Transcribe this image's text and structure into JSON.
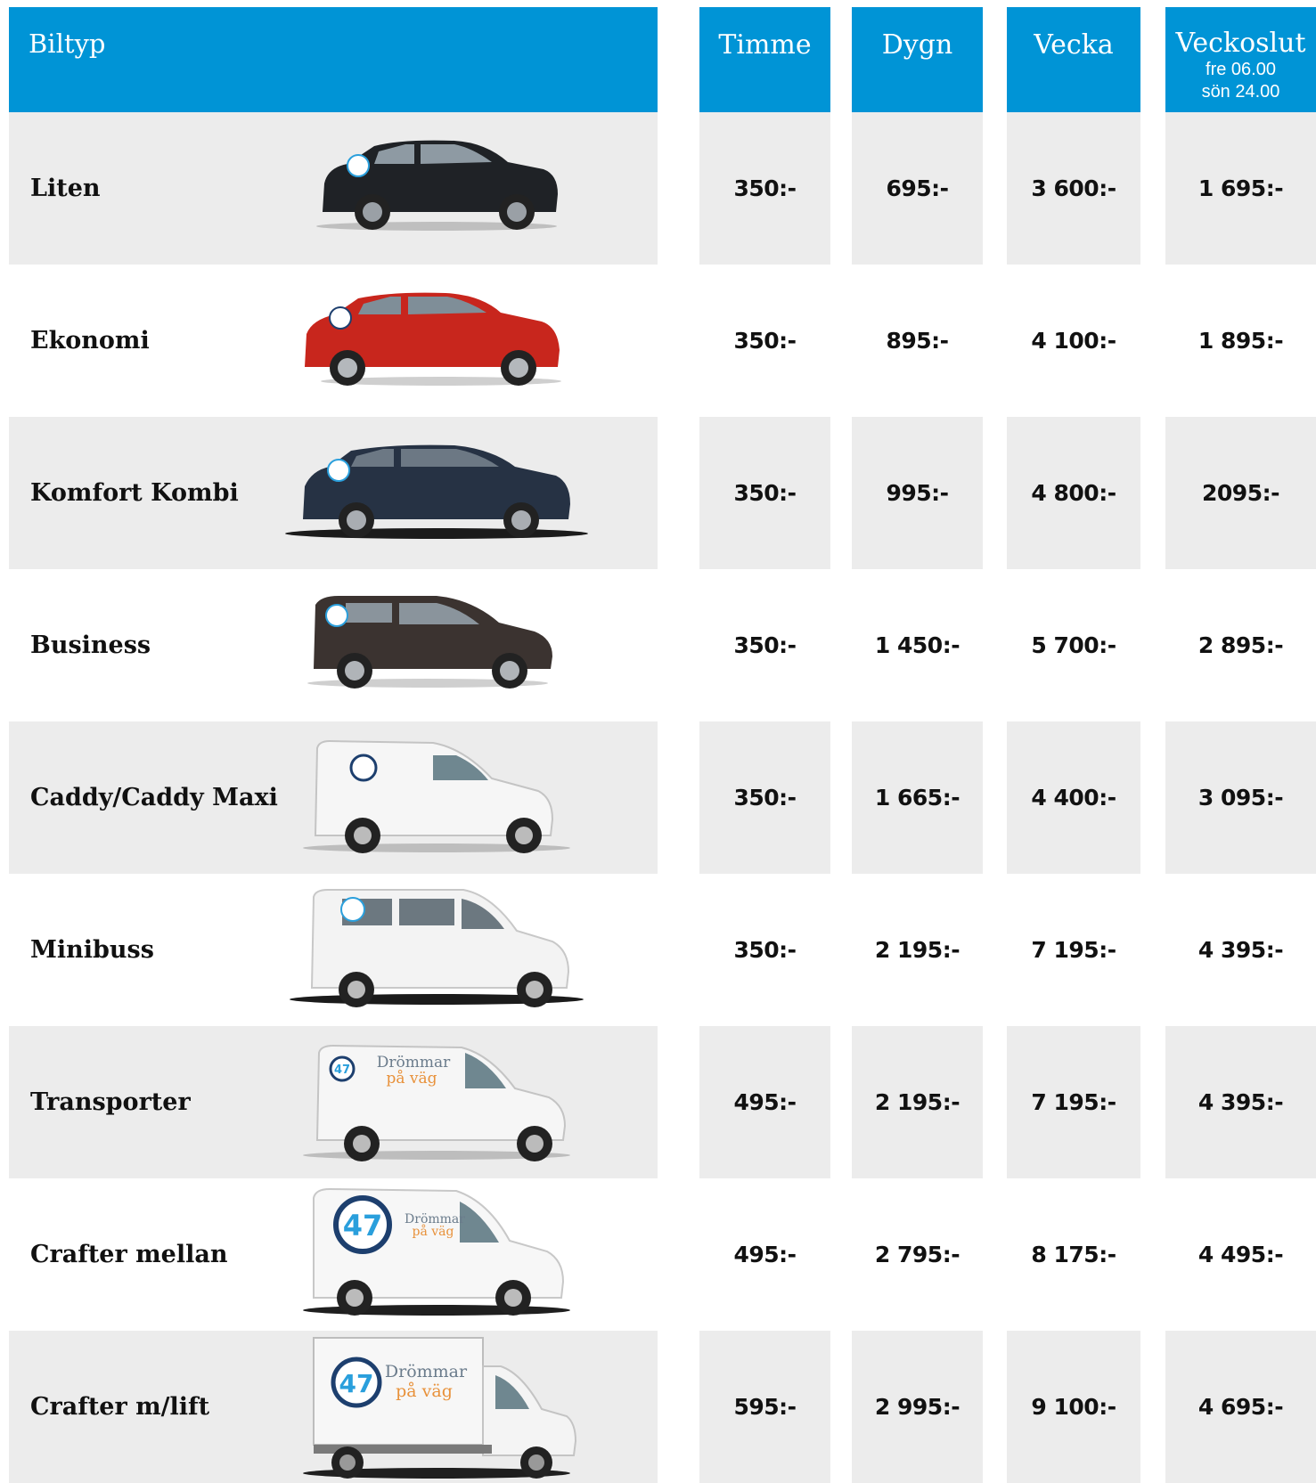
{
  "header": {
    "biltyp": "Biltyp",
    "timme": "Timme",
    "dygn": "Dygn",
    "vecka": "Vecka",
    "veckoslut": "Veckoslut",
    "veckoslut_line1": "fre 06.00",
    "veckoslut_line2": "sön 24.00"
  },
  "colors": {
    "header_bg": "#0094d6",
    "row_shade": "#ececec",
    "logo_blue": "#2a9fdc",
    "logo_navy": "#1d3f6e",
    "slogan_orange": "#e8913a"
  },
  "rows": [
    {
      "name": "Liten",
      "timme": "350:-",
      "dygn": "695:-",
      "vecka": "3 600:-",
      "veckoslut": "1 695:-",
      "vehicle": "hatchback-black"
    },
    {
      "name": "Ekonomi",
      "timme": "350:-",
      "dygn": "895:-",
      "vecka": "4 100:-",
      "veckoslut": "1 895:-",
      "vehicle": "hatchback-red"
    },
    {
      "name": "Komfort Kombi",
      "timme": "350:-",
      "dygn": "995:-",
      "vecka": "4 800:-",
      "veckoslut": "2095:-",
      "vehicle": "estate-dark-blue"
    },
    {
      "name": "Business",
      "timme": "350:-",
      "dygn": "1 450:-",
      "vecka": "5 700:-",
      "veckoslut": "2 895:-",
      "vehicle": "mpv-brown"
    },
    {
      "name": "Caddy/Caddy Maxi",
      "timme": "350:-",
      "dygn": "1 665:-",
      "vecka": "4 400:-",
      "veckoslut": "3 095:-",
      "vehicle": "van-small-white"
    },
    {
      "name": "Minibuss",
      "timme": "350:-",
      "dygn": "2 195:-",
      "vecka": "7 195:-",
      "veckoslut": "4 395:-",
      "vehicle": "minibus-white"
    },
    {
      "name": "Transporter",
      "timme": "495:-",
      "dygn": "2 195:-",
      "vecka": "7 195:-",
      "veckoslut": "4 395:-",
      "vehicle": "van-white",
      "logo_text": "47",
      "slogan1": "Drömmar",
      "slogan2": "på väg"
    },
    {
      "name": "Crafter mellan",
      "timme": "495:-",
      "dygn": "2 795:-",
      "vecka": "8 175:-",
      "veckoslut": "4 495:-",
      "vehicle": "van-tall-white",
      "logo_text": "47",
      "slogan1": "Drömmar",
      "slogan2": "på väg"
    },
    {
      "name": "Crafter m/lift",
      "timme": "595:-",
      "dygn": "2 995:-",
      "vecka": "9 100:-",
      "veckoslut": "4 695:-",
      "vehicle": "box-truck-white",
      "logo_text": "47",
      "slogan1": "Drömmar",
      "slogan2": "på väg"
    }
  ]
}
